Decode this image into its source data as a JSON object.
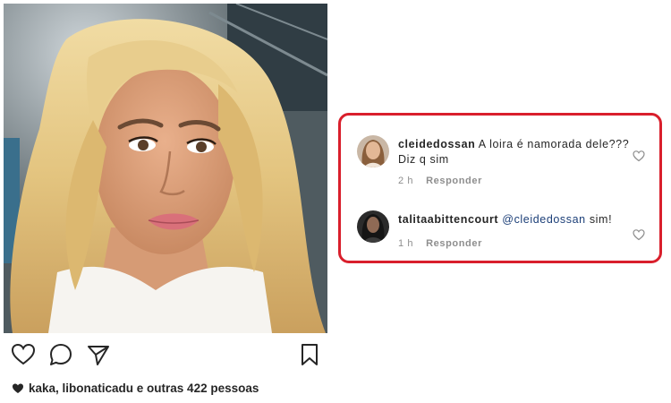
{
  "post": {
    "likes_text": "kaka, libonaticadu e outras 422 pessoas"
  },
  "comments": [
    {
      "username": "cleidedossan",
      "text": "A loira é namorada dele??? Diz q sim",
      "time": "2 h",
      "reply_label": "Responder"
    },
    {
      "username": "talitaabittencourt",
      "mention": "@cleidedossan",
      "text": "sim!",
      "time": "1 h",
      "reply_label": "Responder"
    }
  ],
  "colors": {
    "highlight_border": "#d91f2c",
    "mention": "#1c3f78",
    "meta_text": "#8e8e8e"
  },
  "icons": [
    "heart-icon",
    "comment-icon",
    "share-icon",
    "bookmark-icon"
  ]
}
